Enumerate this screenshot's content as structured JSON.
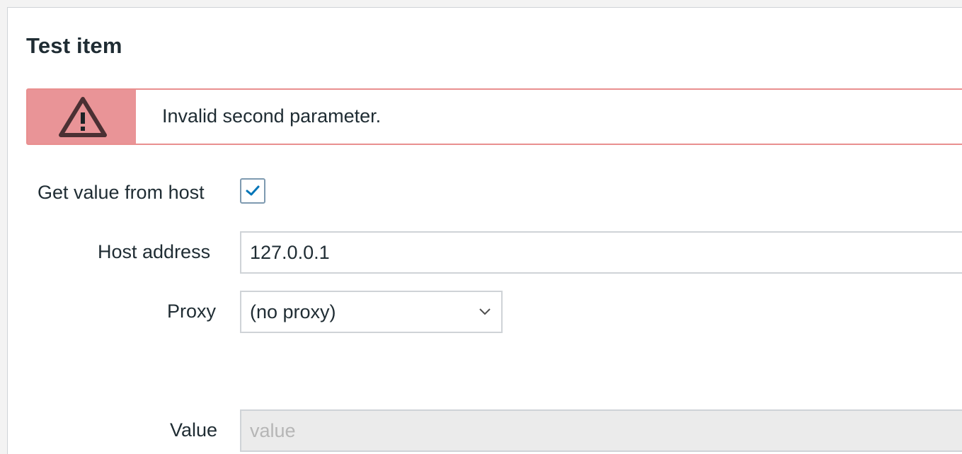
{
  "dialog": {
    "title": "Test item"
  },
  "alert": {
    "icon": "warning-icon",
    "message": "Invalid second parameter.",
    "color": "#e99497"
  },
  "form": {
    "get_value_from_host": {
      "label": "Get value from host",
      "checked": true
    },
    "host_address": {
      "label": "Host address",
      "value": "127.0.0.1"
    },
    "proxy": {
      "label": "Proxy",
      "selected": "(no proxy)",
      "icon": "chevron-down-icon"
    },
    "value": {
      "label": "Value",
      "placeholder": "value",
      "disabled": true
    }
  }
}
